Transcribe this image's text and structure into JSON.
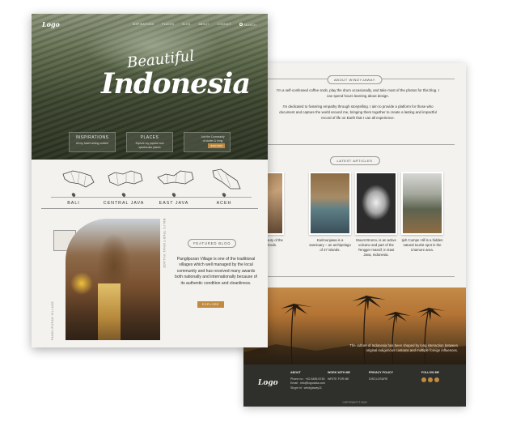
{
  "nav": {
    "logo": "Logo",
    "items": [
      "INSPIRATIONS",
      "PLACES",
      "BLOG",
      "ABOUT",
      "CONTACT"
    ],
    "search_label": "SEARCH"
  },
  "hero": {
    "title_script": "Beautiful",
    "title_main": "Indonesia"
  },
  "hero_cards": [
    {
      "title": "INSPIRATIONS",
      "desc": "All my travel writing content"
    },
    {
      "title": "PLACES",
      "desc": "Explore my popular and spectacular places"
    },
    {
      "title": "",
      "desc": "Join the Community of stories & bring",
      "button": "JOIN NOW"
    }
  ],
  "regions": [
    "BALI",
    "CENTRAL JAVA",
    "EAST JAVA",
    "ACEH"
  ],
  "featured": {
    "pill": "FEATURED BLOG",
    "text": "Panglipuran Village is one of the traditional villages which well managed by the local community and has received many awards both nationally and internationally because of its authentic condition and cleanliness.",
    "button": "EXPLORE",
    "vtext_left": "PANGLIPURAN VILLAGE",
    "vtext_right": "BALI'S TRADITIONAL VILLAGE"
  },
  "about": {
    "pill": "ABOUT WINDYJAWAY",
    "p1": "I'm a self-confessed coffee snob, play the drum occasionally, and take most of the photos for this blog. I can spend hours learning about design.",
    "p2": "I'm dedicated to fostering empathy through storytelling. I aim to provide a platform for those who document and capture the world around me, bringing them together to create a lasting and impactful record of life on Earth that I can all experience."
  },
  "latest": {
    "pill": "LATEST ARTICLES",
    "articles": [
      {
        "caption": "Bali, Natural Beauty of the Land of the Gods."
      },
      {
        "caption": "Karimunjawa is a sanctuary – an archipelago of 27 islands."
      },
      {
        "caption": "Mount Bromo, is an active volcano and part of the Tengger massif, in East Java, Indonesia."
      },
      {
        "caption": "Ijeh Cumpe Hill is a hidden natural tourist spot in the Lhamore area."
      }
    ]
  },
  "banner_caption": "The culture of Indonesia has been shaped by long interaction between original indigenous customs and multiple foreign influences.",
  "footer": {
    "logo": "Logo",
    "col1": {
      "head": "ABOUT",
      "lines": [
        "Phone no : +62 8456 6745",
        "Email : info@logodata.com",
        "Skype id : windyjaway11"
      ]
    },
    "col2": {
      "head": "WORK WITH ME",
      "lines": [
        "WRITE FOR ME"
      ]
    },
    "col3": {
      "head": "PRIVACY POLICY",
      "lines": [
        "DISCLOSURE"
      ]
    },
    "col4": {
      "head": "FOLLOW ME"
    },
    "copyright": "COPYRIGHT © 2020"
  },
  "colors": {
    "accent": "#c08a40",
    "footer_bg": "#2f2f2b",
    "page_bg": "#f4f2ee"
  }
}
